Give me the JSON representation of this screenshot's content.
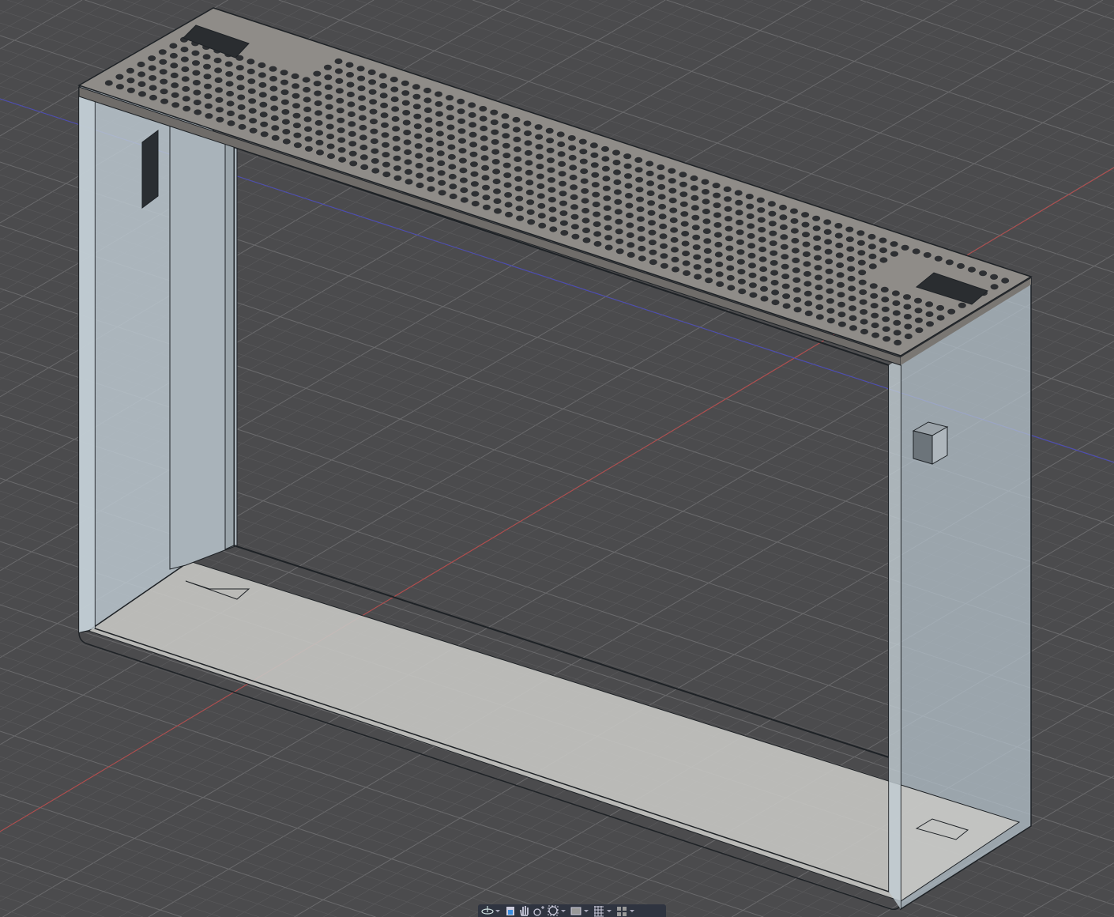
{
  "viewport": {
    "colors": {
      "background": "#4b4b4d",
      "grid_minor": "#5a5a5c",
      "grid_major": "#6a6a6c",
      "axis_x": "#b84a4a",
      "axis_y": "#4a4ab8",
      "body_top": "#8f8c88",
      "glass": "#b9c6cf",
      "edge": "#1e2226"
    }
  },
  "navbar": {
    "tools": [
      {
        "icon": "orbit-icon",
        "has_menu": true
      },
      {
        "icon": "look-at-icon",
        "has_menu": false
      },
      {
        "icon": "pan-hand-icon",
        "has_menu": false
      },
      {
        "icon": "zoom-icon",
        "has_menu": false
      },
      {
        "icon": "fit-window-icon",
        "has_menu": true
      },
      {
        "icon": "display-settings-icon",
        "has_menu": true
      },
      {
        "icon": "grid-settings-icon",
        "has_menu": true
      },
      {
        "icon": "viewports-icon",
        "has_menu": true
      }
    ]
  }
}
